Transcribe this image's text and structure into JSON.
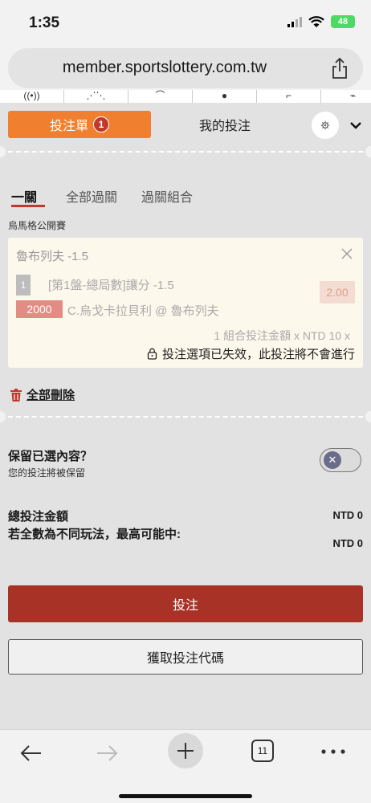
{
  "status_bar": {
    "time": "1:35",
    "battery": "48"
  },
  "browser": {
    "url": "member.sportslottery.com.tw",
    "tab_count": "11"
  },
  "tabs": {
    "bet_slip": "投注單",
    "bet_slip_count": "1",
    "my_bets": "我的投注"
  },
  "subtabs": {
    "single": "一關",
    "all_parlay": "全部過關",
    "parlay_combo": "過關組合"
  },
  "league": "烏馬格公開賽",
  "bet": {
    "title": "魯布列夫 -1.5",
    "leg_number": "1",
    "market": "[第1盤-總局數]讓分 -1.5",
    "odds": "2.00",
    "stake": "2000",
    "match": "C.烏戈卡拉貝利 @ 魯布列夫",
    "combo_info": "1 組合投注金額 x NTD 10 x",
    "expired_notice": "投注選項已失效，此投注將不會進行"
  },
  "delete_all": "全部刪除",
  "keep_selection": {
    "title": "保留已選內容？",
    "subtitle": "您的投注將被保留",
    "enabled": false
  },
  "totals": {
    "total_label": "總投注金額",
    "total_value": "NTD 0",
    "max_label": "若全數為不同玩法，最高可能中:",
    "max_value": "NTD 0"
  },
  "buttons": {
    "place_bet": "投注",
    "get_code": "獲取投注代碼"
  },
  "colors": {
    "accent_orange": "#f07f2f",
    "primary_red": "#a93226",
    "badge_red": "#c0392b"
  }
}
